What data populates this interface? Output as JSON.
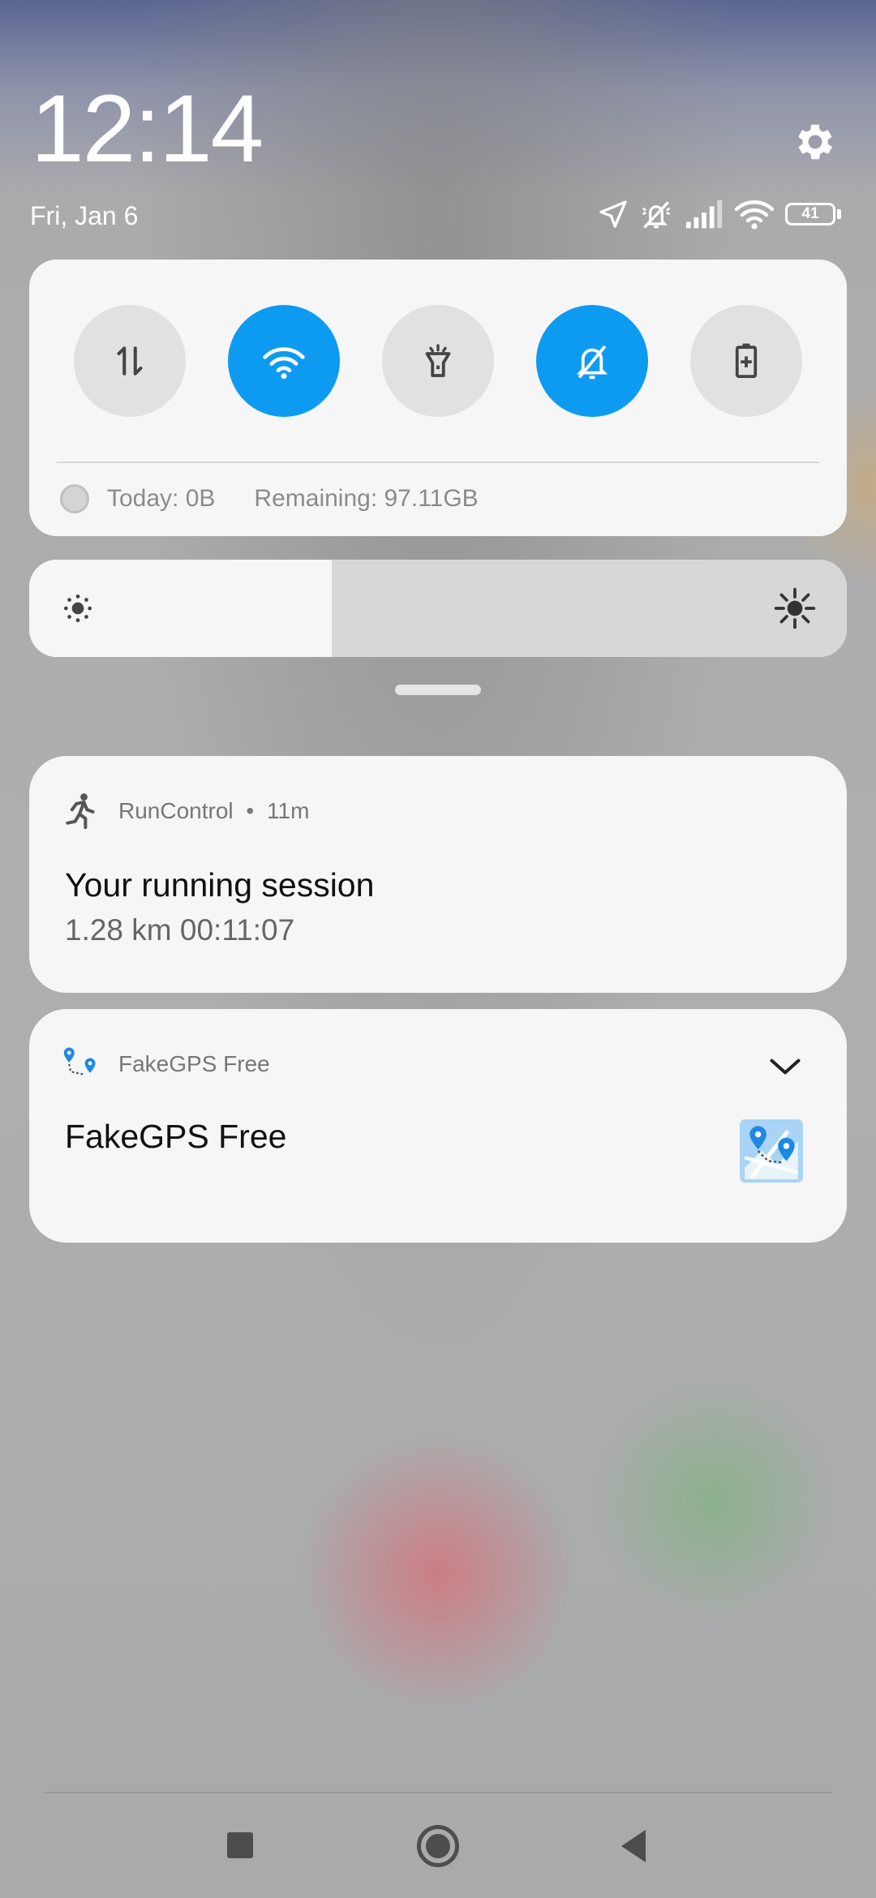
{
  "header": {
    "time": "12:14",
    "date": "Fri, Jan 6",
    "battery_level": "41",
    "icons": [
      "gear-icon",
      "location-icon",
      "vibrate-off-icon",
      "signal-icon",
      "wifi-icon",
      "battery-icon"
    ]
  },
  "quick_settings": {
    "tiles": [
      {
        "name": "mobile-data",
        "icon": "data-arrows-icon",
        "active": false
      },
      {
        "name": "wifi",
        "icon": "wifi-icon",
        "active": true
      },
      {
        "name": "flashlight",
        "icon": "flashlight-icon",
        "active": false
      },
      {
        "name": "silent",
        "icon": "bell-off-icon",
        "active": true
      },
      {
        "name": "battery-saver",
        "icon": "battery-plus-icon",
        "active": false
      }
    ],
    "data_today": "Today: 0B",
    "data_remaining": "Remaining: 97.11GB"
  },
  "brightness": {
    "level": 0.37
  },
  "notifications": [
    {
      "app": "RunControl",
      "time": "11m",
      "title": "Your running session",
      "text": "1.28 km 00:11:07",
      "icon": "runner-icon"
    },
    {
      "app": "FakeGPS Free",
      "title": "FakeGPS Free",
      "icon": "map-pins-icon",
      "thumbnail": "map-thumbnail-icon"
    }
  ],
  "colors": {
    "accent": "#0d9bf2",
    "panel": "#f6f6f6"
  }
}
